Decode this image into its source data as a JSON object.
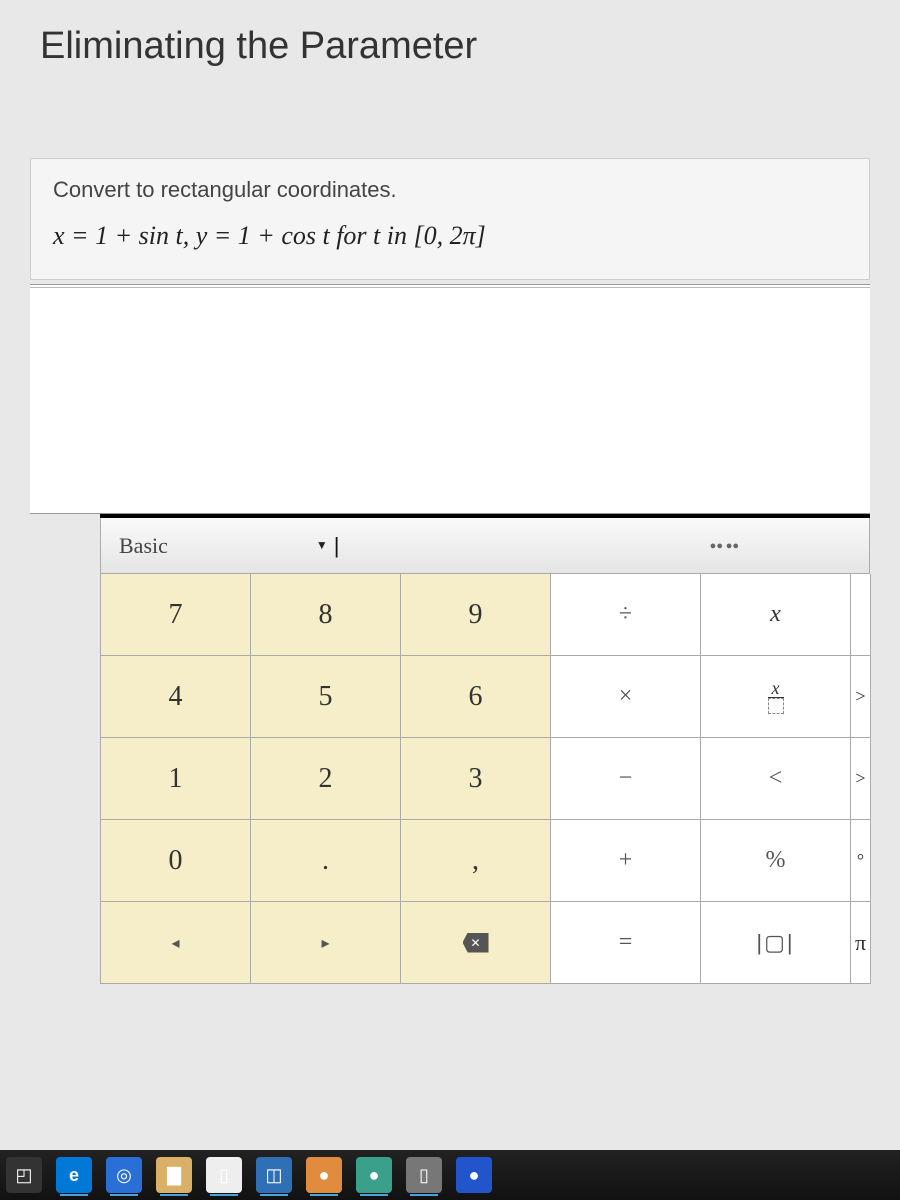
{
  "page_title": "Eliminating the Parameter",
  "problem": {
    "instruction": "Convert to rectangular coordinates.",
    "equation": "x = 1 + sin t,  y = 1 + cos t  for  t  in  [0,  2π]"
  },
  "keypad": {
    "mode_label": "Basic",
    "dropdown_glyph": "▼",
    "cursor_glyph": "|",
    "indicator": "●● ●●",
    "rows": [
      [
        {
          "label": "7",
          "cls": "num"
        },
        {
          "label": "8",
          "cls": "num"
        },
        {
          "label": "9",
          "cls": "num"
        },
        {
          "label": "÷",
          "cls": "op"
        },
        {
          "label": "x",
          "cls": "var"
        },
        {
          "label": "",
          "cls": "edge"
        }
      ],
      [
        {
          "label": "4",
          "cls": "num"
        },
        {
          "label": "5",
          "cls": "num"
        },
        {
          "label": "6",
          "cls": "num"
        },
        {
          "label": "×",
          "cls": "op"
        },
        {
          "label": "frac",
          "cls": "var"
        },
        {
          "label": ">",
          "cls": "edge small"
        }
      ],
      [
        {
          "label": "1",
          "cls": "num"
        },
        {
          "label": "2",
          "cls": "num"
        },
        {
          "label": "3",
          "cls": "num"
        },
        {
          "label": "−",
          "cls": "op"
        },
        {
          "label": "<",
          "cls": "op"
        },
        {
          "label": ">",
          "cls": "edge small"
        }
      ],
      [
        {
          "label": "0",
          "cls": "num"
        },
        {
          "label": ".",
          "cls": "num"
        },
        {
          "label": ",",
          "cls": "num"
        },
        {
          "label": "+",
          "cls": "op"
        },
        {
          "label": "%",
          "cls": "op"
        },
        {
          "label": "°",
          "cls": "edge small"
        }
      ],
      [
        {
          "label": "◂",
          "cls": "num small"
        },
        {
          "label": "▸",
          "cls": "num small"
        },
        {
          "label": "del",
          "cls": "num"
        },
        {
          "label": "=",
          "cls": "op"
        },
        {
          "label": "abs",
          "cls": "op"
        },
        {
          "label": "π",
          "cls": "edge"
        }
      ]
    ]
  },
  "taskbar": {
    "items": [
      {
        "name": "start",
        "glyph": "◰"
      },
      {
        "name": "edge",
        "glyph": "e"
      },
      {
        "name": "cortana",
        "glyph": "◎"
      },
      {
        "name": "explorer",
        "glyph": "▇"
      },
      {
        "name": "doc",
        "glyph": "▯"
      },
      {
        "name": "store",
        "glyph": "◫"
      },
      {
        "name": "app1",
        "glyph": "●"
      },
      {
        "name": "app2",
        "glyph": "●"
      },
      {
        "name": "app3",
        "glyph": "▯"
      },
      {
        "name": "app4",
        "glyph": "●"
      }
    ]
  }
}
